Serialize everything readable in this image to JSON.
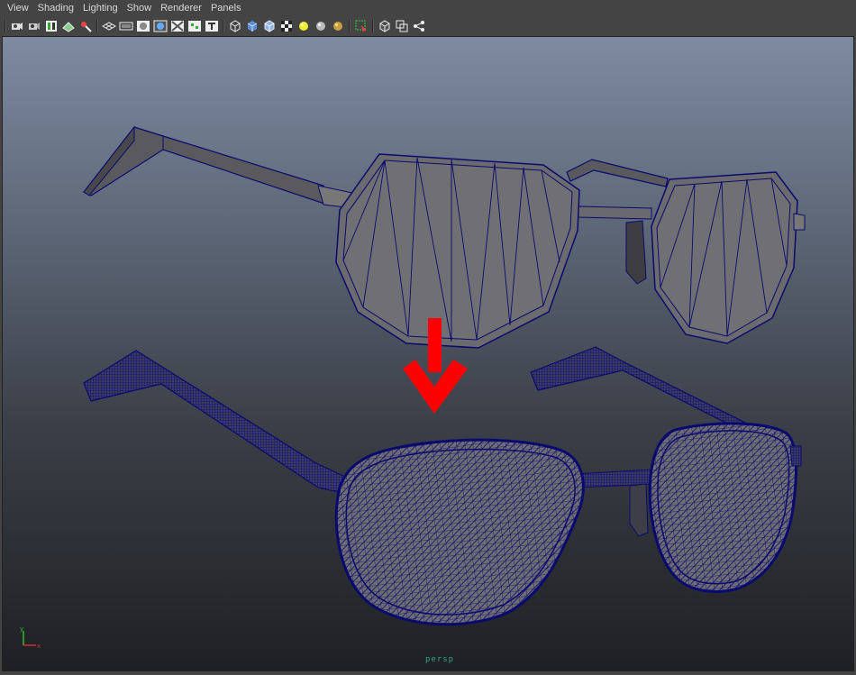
{
  "menu": {
    "items": [
      "View",
      "Shading",
      "Lighting",
      "Show",
      "Renderer",
      "Panels"
    ]
  },
  "toolbar": {
    "icons": [
      "camera-select-icon",
      "camera-attributes-icon",
      "bookmark-icon",
      "image-plane-icon",
      "2d-pan-zoom-icon",
      "grid-icon",
      "film-gate-icon",
      "resolution-gate-icon",
      "gate-mask-icon",
      "field-chart-icon",
      "safe-action-icon",
      "safe-title-icon",
      "wireframe-icon",
      "smooth-shade-icon",
      "wireframe-on-shaded-icon",
      "textured-icon",
      "use-all-lights-icon",
      "shadows-icon",
      "ambient-occlusion-icon",
      "isolate-select-icon",
      "xray-icon",
      "xray-active-components-icon",
      "xray-joints-icon"
    ]
  },
  "viewport": {
    "camera": "persp",
    "background_top": "#7e8aa0",
    "background_bottom": "#1f2024",
    "mesh_wire_color": "#0a0a6e",
    "mesh_fill_color": "#6b6b6b",
    "arrow_color": "#ff0000"
  },
  "axis": {
    "x": "x",
    "y": "y"
  }
}
